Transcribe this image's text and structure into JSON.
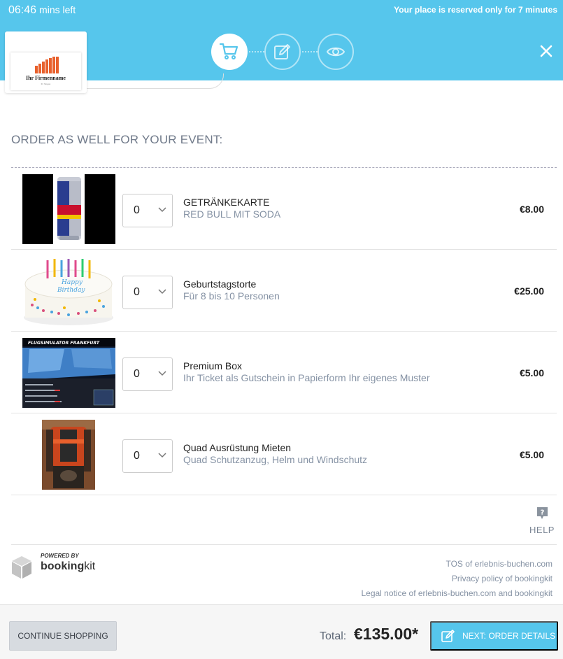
{
  "header": {
    "timer_value": "06:46",
    "timer_unit": "mins left",
    "reserved_notice": "Your place is reserved only for 7 minutes",
    "logo_name": "Ihr Firmenname",
    "logo_slogan": "Ihr Slogan",
    "steps": [
      {
        "icon": "cart-icon",
        "active": true
      },
      {
        "icon": "edit-icon",
        "active": false
      },
      {
        "icon": "eye-icon",
        "active": false
      }
    ]
  },
  "section": {
    "title": "ORDER AS WELL FOR YOUR EVENT:"
  },
  "items": [
    {
      "title": "GETRÄNKEKARTE",
      "subtitle": "RED BULL MIT SODA",
      "qty": "0",
      "price": "€8.00"
    },
    {
      "title": "Geburtstagstorte",
      "subtitle": "Für 8 bis 10 Personen",
      "qty": "0",
      "price": "€25.00"
    },
    {
      "title": "Premium Box",
      "subtitle": "Ihr Ticket als Gutschein in Papierform Ihr eigenes Muster",
      "qty": "0",
      "price": "€5.00"
    },
    {
      "title": "Quad Ausrüstung Mieten",
      "subtitle": "Quad Schutzanzug, Helm und Windschutz",
      "qty": "0",
      "price": "€5.00"
    }
  ],
  "images": {
    "cake_text_1": "Happy",
    "cake_text_2": "Birthday",
    "sim_title": "FLUGSIMULATOR FRANKFURT"
  },
  "help": {
    "label": "HELP"
  },
  "footer": {
    "powered_by": "POWERED BY",
    "brand_bold": "booking",
    "brand_light": "kit",
    "links": [
      "TOS of erlebnis-buchen.com",
      "Privacy policy of bookingkit",
      "Legal notice of erlebnis-buchen.com and bookingkit"
    ]
  },
  "bottom": {
    "continue_label": "CONTINUE SHOPPING",
    "total_label": "Total:",
    "total_value": "€135.00*",
    "next_label": "NEXT: ORDER DETAILS"
  },
  "colors": {
    "accent": "#56c6ec",
    "logo": "#e8602c"
  }
}
